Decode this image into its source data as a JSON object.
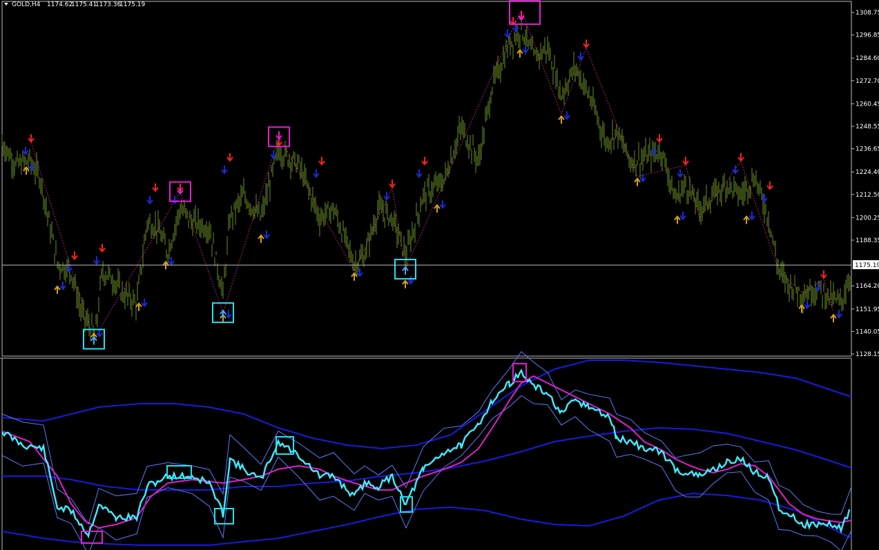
{
  "window": {
    "symbol_title": "GOLD,H4",
    "ohlc": [
      "1174.62",
      "1175.41",
      "1173.36",
      "1175.19"
    ]
  },
  "colors": {
    "background": "#000000",
    "price_bars": "#6b8e23",
    "zigzag": "#b0207a",
    "frame": "#c0c0c0",
    "arrow_up_gold": "#d4a017",
    "arrow_up_blue": "#1e90ff",
    "arrow_down_red": "#ff2020",
    "arrow_down_navy": "#1a2bd8",
    "signal_box_buy": "#22e3f0",
    "signal_box_sell": "#e020d0",
    "osc_line": "#40e8ff",
    "osc_signal": "#e020d0",
    "osc_band_thin": "#5a7cff",
    "osc_band_thick": "#1a1ae0",
    "current_price_line": "#c0c0c0"
  },
  "chart_data": [
    {
      "type": "bar",
      "title": "GOLD,H4",
      "ylim": [
        1128.15,
        1310
      ],
      "y_ticks": [
        "1308.75",
        "1296.85",
        "1284.60",
        "1272.70",
        "1260.45",
        "1248.55",
        "1236.65",
        "1224.40",
        "1212.50",
        "1200.25",
        "1188.35",
        "1175.19",
        "1164.20",
        "1151.95",
        "1140.05",
        "1128.15"
      ],
      "current_price": "1175.19",
      "x": [
        0,
        20,
        40,
        55,
        80,
        100,
        115,
        135,
        145,
        160,
        175,
        195,
        210,
        225,
        240,
        258,
        275,
        300,
        320,
        330,
        350,
        375,
        400,
        430,
        460,
        480,
        510,
        525,
        545,
        565,
        585,
        610,
        640,
        665,
        690,
        710,
        735,
        752,
        770,
        790,
        810,
        830,
        850,
        875,
        890,
        910,
        930,
        955,
        975,
        990,
        1010,
        1030,
        1050,
        1070,
        1090,
        1110,
        1125,
        1140,
        1160,
        1180,
        1200,
        1215,
        1230
      ],
      "close": [
        1240,
        1228,
        1230,
        1222,
        1176,
        1172,
        1150,
        1138,
        1172,
        1168,
        1160,
        1155,
        1198,
        1195,
        1182,
        1205,
        1198,
        1195,
        1160,
        1200,
        1212,
        1200,
        1236,
        1228,
        1200,
        1205,
        1176,
        1180,
        1205,
        1200,
        1180,
        1212,
        1220,
        1248,
        1230,
        1270,
        1292,
        1300,
        1285,
        1290,
        1265,
        1280,
        1265,
        1240,
        1246,
        1230,
        1232,
        1236,
        1210,
        1218,
        1205,
        1212,
        1218,
        1212,
        1222,
        1200,
        1172,
        1165,
        1160,
        1163,
        1158,
        1155,
        1172
      ],
      "signals": [
        {
          "kind": "buy",
          "x": 133,
          "price": 1136
        },
        {
          "kind": "sell",
          "x": 258,
          "price": 1214
        },
        {
          "kind": "buy",
          "x": 320,
          "price": 1150
        },
        {
          "kind": "sell",
          "x": 401,
          "price": 1243
        },
        {
          "kind": "buy",
          "x": 584,
          "price": 1173
        },
        {
          "kind": "sell",
          "x": 752,
          "price": 1310
        }
      ],
      "arrows_up": [
        [
          35,
          1228
        ],
        [
          80,
          1165
        ],
        [
          133,
          1140
        ],
        [
          198,
          1156
        ],
        [
          237,
          1178
        ],
        [
          320,
          1150
        ],
        [
          375,
          1192
        ],
        [
          510,
          1172
        ],
        [
          584,
          1168
        ],
        [
          630,
          1208
        ],
        [
          750,
          1290
        ],
        [
          810,
          1255
        ],
        [
          920,
          1222
        ],
        [
          978,
          1202
        ],
        [
          1078,
          1202
        ],
        [
          1158,
          1155
        ],
        [
          1204,
          1150
        ]
      ],
      "arrows_down": [
        [
          42,
          1240
        ],
        [
          105,
          1178
        ],
        [
          145,
          1182
        ],
        [
          222,
          1214
        ],
        [
          258,
          1214
        ],
        [
          330,
          1230
        ],
        [
          401,
          1238
        ],
        [
          463,
          1228
        ],
        [
          565,
          1216
        ],
        [
          612,
          1228
        ],
        [
          740,
          1302
        ],
        [
          752,
          1305
        ],
        [
          846,
          1290
        ],
        [
          952,
          1240
        ],
        [
          990,
          1228
        ],
        [
          1070,
          1230
        ],
        [
          1112,
          1215
        ],
        [
          1190,
          1168
        ]
      ],
      "zigzag": [
        [
          42,
          1240
        ],
        [
          133,
          1136
        ],
        [
          258,
          1214
        ],
        [
          320,
          1150
        ],
        [
          401,
          1243
        ],
        [
          510,
          1172
        ],
        [
          565,
          1216
        ],
        [
          584,
          1173
        ],
        [
          752,
          1310
        ],
        [
          810,
          1255
        ],
        [
          846,
          1290
        ],
        [
          920,
          1222
        ],
        [
          990,
          1228
        ],
        [
          1010,
          1200
        ],
        [
          1070,
          1230
        ],
        [
          1125,
          1172
        ],
        [
          1160,
          1160
        ],
        [
          1190,
          1168
        ],
        [
          1204,
          1150
        ]
      ]
    },
    {
      "type": "line",
      "title": "",
      "series": [
        {
          "values": [
            [
              0,
              625
            ],
            [
              30,
              645
            ],
            [
              60,
              650
            ],
            [
              80,
              735
            ],
            [
              100,
              740
            ],
            [
              125,
              775
            ],
            [
              140,
              730
            ],
            [
              165,
              750
            ],
            [
              195,
              750
            ],
            [
              210,
              705
            ],
            [
              240,
              690
            ],
            [
              275,
              690
            ],
            [
              300,
              700
            ],
            [
              320,
              745
            ],
            [
              330,
              665
            ],
            [
              350,
              680
            ],
            [
              375,
              695
            ],
            [
              400,
              640
            ],
            [
              430,
              660
            ],
            [
              460,
              690
            ],
            [
              480,
              690
            ],
            [
              510,
              720
            ],
            [
              525,
              700
            ],
            [
              545,
              705
            ],
            [
              565,
              690
            ],
            [
              585,
              730
            ],
            [
              610,
              680
            ],
            [
              640,
              655
            ],
            [
              665,
              645
            ],
            [
              690,
              615
            ],
            [
              710,
              580
            ],
            [
              735,
              555
            ],
            [
              752,
              540
            ],
            [
              770,
              560
            ],
            [
              790,
              570
            ],
            [
              810,
              600
            ],
            [
              830,
              580
            ],
            [
              850,
              590
            ],
            [
              880,
              605
            ],
            [
              890,
              635
            ],
            [
              910,
              640
            ],
            [
              930,
              650
            ],
            [
              955,
              655
            ],
            [
              975,
              680
            ],
            [
              990,
              685
            ],
            [
              1010,
              690
            ],
            [
              1030,
              680
            ],
            [
              1050,
              670
            ],
            [
              1070,
              665
            ],
            [
              1090,
              685
            ],
            [
              1110,
              690
            ],
            [
              1125,
              735
            ],
            [
              1140,
              745
            ],
            [
              1160,
              760
            ],
            [
              1180,
              760
            ],
            [
              1200,
              760
            ],
            [
              1215,
              765
            ],
            [
              1230,
              735
            ]
          ]
        },
        {
          "values": [
            [
              0,
              625
            ],
            [
              40,
              640
            ],
            [
              80,
              690
            ],
            [
              100,
              730
            ],
            [
              120,
              755
            ],
            [
              140,
              765
            ],
            [
              165,
              760
            ],
            [
              195,
              750
            ],
            [
              215,
              720
            ],
            [
              240,
              700
            ],
            [
              275,
              695
            ],
            [
              320,
              700
            ],
            [
              350,
              695
            ],
            [
              375,
              690
            ],
            [
              400,
              680
            ],
            [
              430,
              675
            ],
            [
              460,
              680
            ],
            [
              480,
              690
            ],
            [
              510,
              700
            ],
            [
              545,
              710
            ],
            [
              565,
              710
            ],
            [
              585,
              700
            ],
            [
              610,
              690
            ],
            [
              640,
              680
            ],
            [
              665,
              670
            ],
            [
              690,
              650
            ],
            [
              710,
              620
            ],
            [
              735,
              580
            ],
            [
              752,
              555
            ],
            [
              770,
              545
            ],
            [
              790,
              555
            ],
            [
              810,
              565
            ],
            [
              830,
              575
            ],
            [
              850,
              585
            ],
            [
              880,
              600
            ],
            [
              910,
              620
            ],
            [
              930,
              640
            ],
            [
              955,
              652
            ],
            [
              975,
              665
            ],
            [
              990,
              672
            ],
            [
              1010,
              680
            ],
            [
              1030,
              685
            ],
            [
              1050,
              680
            ],
            [
              1070,
              672
            ],
            [
              1090,
              675
            ],
            [
              1110,
              690
            ],
            [
              1125,
              710
            ],
            [
              1140,
              730
            ],
            [
              1160,
              745
            ],
            [
              1180,
              752
            ],
            [
              1200,
              755
            ],
            [
              1215,
              757
            ],
            [
              1230,
              754
            ]
          ]
        },
        {
          "values": [
            [
              0,
              605
            ],
            [
              60,
              610
            ],
            [
              100,
              600
            ],
            [
              140,
              590
            ],
            [
              200,
              585
            ],
            [
              250,
              585
            ],
            [
              300,
              590
            ],
            [
              350,
              600
            ],
            [
              400,
              620
            ],
            [
              450,
              635
            ],
            [
              500,
              645
            ],
            [
              550,
              650
            ],
            [
              600,
              645
            ],
            [
              650,
              630
            ],
            [
              700,
              595
            ],
            [
              750,
              560
            ],
            [
              800,
              535
            ],
            [
              850,
              522
            ],
            [
              900,
              522
            ],
            [
              950,
              525
            ],
            [
              1000,
              530
            ],
            [
              1050,
              535
            ],
            [
              1100,
              540
            ],
            [
              1150,
              548
            ],
            [
              1200,
              565
            ],
            [
              1230,
              575
            ]
          ]
        },
        {
          "values": [
            [
              0,
              690
            ],
            [
              60,
              690
            ],
            [
              100,
              695
            ],
            [
              150,
              705
            ],
            [
              200,
              710
            ],
            [
              250,
              710
            ],
            [
              300,
              710
            ],
            [
              350,
              705
            ],
            [
              400,
              705
            ],
            [
              450,
              700
            ],
            [
              500,
              697
            ],
            [
              550,
              690
            ],
            [
              600,
              685
            ],
            [
              650,
              678
            ],
            [
              700,
              668
            ],
            [
              750,
              655
            ],
            [
              800,
              640
            ],
            [
              850,
              632
            ],
            [
              900,
              625
            ],
            [
              950,
              620
            ],
            [
              1000,
              622
            ],
            [
              1050,
              628
            ],
            [
              1100,
              640
            ],
            [
              1150,
              652
            ],
            [
              1200,
              668
            ],
            [
              1230,
              678
            ]
          ]
        },
        {
          "values": [
            [
              0,
              770
            ],
            [
              60,
              780
            ],
            [
              100,
              785
            ],
            [
              150,
              788
            ],
            [
              200,
              790
            ],
            [
              250,
              790
            ],
            [
              300,
              790
            ],
            [
              350,
              785
            ],
            [
              400,
              780
            ],
            [
              450,
              770
            ],
            [
              500,
              760
            ],
            [
              550,
              748
            ],
            [
              600,
              738
            ],
            [
              650,
              735
            ],
            [
              700,
              740
            ],
            [
              750,
              752
            ],
            [
              800,
              760
            ],
            [
              850,
              762
            ],
            [
              900,
              748
            ],
            [
              950,
              725
            ],
            [
              1000,
              715
            ],
            [
              1050,
              718
            ],
            [
              1100,
              725
            ],
            [
              1150,
              740
            ],
            [
              1200,
              765
            ],
            [
              1230,
              780
            ]
          ]
        }
      ]
    }
  ]
}
